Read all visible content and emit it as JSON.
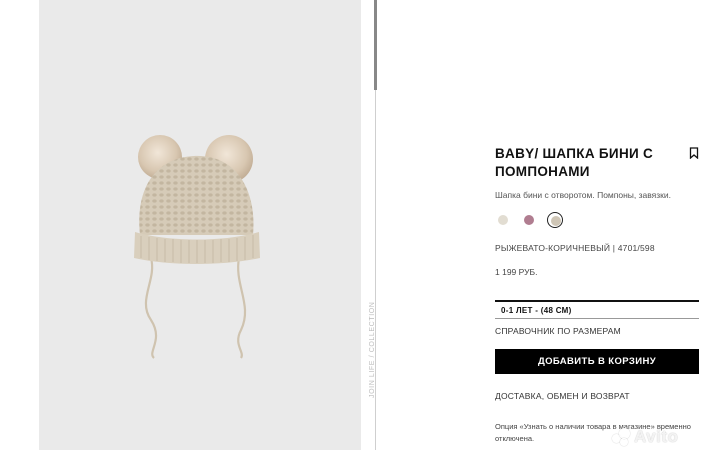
{
  "product": {
    "title": "BABY/ ШАПКА БИНИ С ПОМПОНАМИ",
    "description": "Шапка бини с отворотом. Помпоны, завязки.",
    "color_line": "РЫЖЕВАТО-КОРИЧНЕВЫЙ | 4701/598",
    "price": "1 199 РУБ.",
    "image_label": "JOIN LIFE / COLLECTION"
  },
  "swatches": [
    {
      "name": "beige",
      "color": "#e2ddd2"
    },
    {
      "name": "mauve",
      "color": "#b07d90"
    },
    {
      "name": "taupe",
      "color": "#cfc6b6",
      "selected": true
    }
  ],
  "size": {
    "selected": "0-1 ЛЕТ - (48 СМ)"
  },
  "links": {
    "size_guide": "СПРАВОЧНИК ПО РАЗМЕРАМ",
    "delivery": "ДОСТАВКА, ОБМЕН И ВОЗВРАТ"
  },
  "buttons": {
    "add_to_cart": "ДОБАВИТЬ В КОРЗИНУ"
  },
  "notice": "Опция «Узнать о наличии товара в магазине» временно отключена.",
  "watermark": "Avito",
  "icons": {
    "bookmark": "bookmark-icon"
  },
  "colors": {
    "button_bg": "#000000",
    "panel_bg": "#eaeaea"
  }
}
